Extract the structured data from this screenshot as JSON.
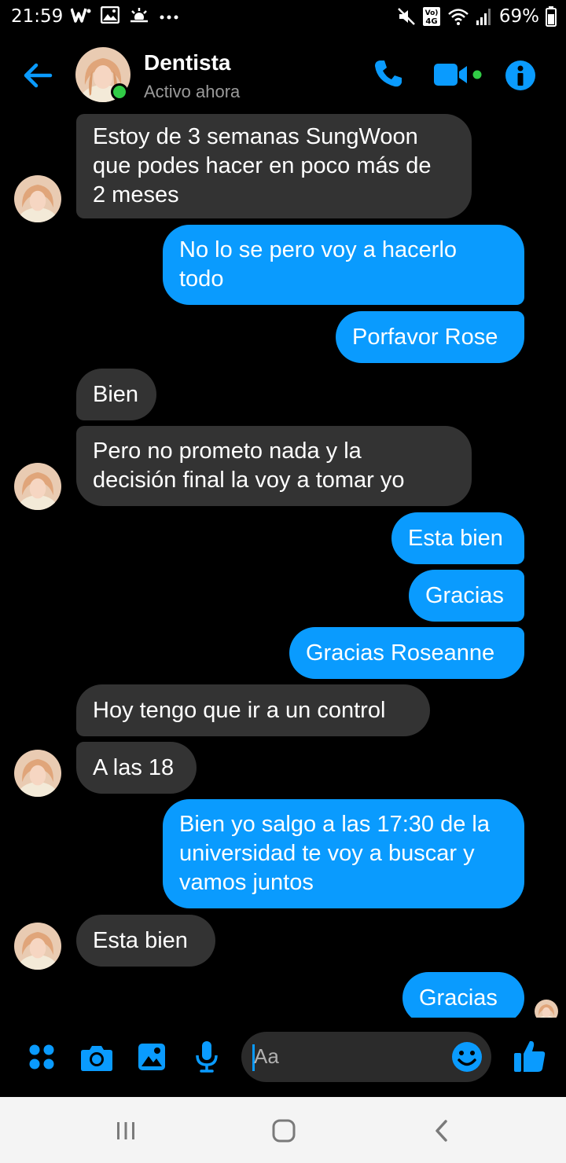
{
  "status_bar": {
    "time": "21:59",
    "battery": "69%",
    "network": "Vo) 4G"
  },
  "header": {
    "name": "Dentista",
    "status": "Activo ahora"
  },
  "messages": [
    {
      "dir": "in",
      "lines": [
        "Estoy de 3 semanas SungWoon",
        "que podes hacer en poco más de",
        "2 meses"
      ]
    },
    {
      "dir": "out",
      "lines": [
        "No lo se pero voy a hacerlo",
        "todo"
      ]
    },
    {
      "dir": "out",
      "lines": [
        "Porfavor Rose"
      ]
    },
    {
      "dir": "in",
      "lines": [
        "Bien"
      ]
    },
    {
      "dir": "in",
      "lines": [
        "Pero no prometo nada y la",
        "decisión final la voy a tomar yo"
      ]
    },
    {
      "dir": "out",
      "lines": [
        "Esta bien"
      ]
    },
    {
      "dir": "out",
      "lines": [
        "Gracias"
      ]
    },
    {
      "dir": "out",
      "lines": [
        "Gracias Roseanne"
      ]
    },
    {
      "dir": "in",
      "lines": [
        "Hoy tengo que ir a un control"
      ]
    },
    {
      "dir": "in",
      "lines": [
        "A las 18"
      ]
    },
    {
      "dir": "out",
      "lines": [
        "Bien yo salgo a las 17:30 de la",
        "universidad te voy a buscar y",
        "vamos juntos"
      ]
    },
    {
      "dir": "in",
      "lines": [
        "Esta bien"
      ]
    },
    {
      "dir": "out",
      "lines": [
        "Gracias"
      ]
    }
  ],
  "composer": {
    "placeholder": "Aa"
  },
  "colors": {
    "accent": "#0a9bfe",
    "incoming_bubble": "#333333",
    "background": "#000000",
    "online": "#31cc46"
  },
  "icons": [
    "back-arrow-icon",
    "phone-icon",
    "video-camera-icon",
    "info-icon",
    "apps-icon",
    "camera-icon",
    "image-icon",
    "microphone-icon",
    "emoji-icon",
    "thumbs-up-icon",
    "recent-apps-icon",
    "home-icon",
    "back-icon"
  ]
}
